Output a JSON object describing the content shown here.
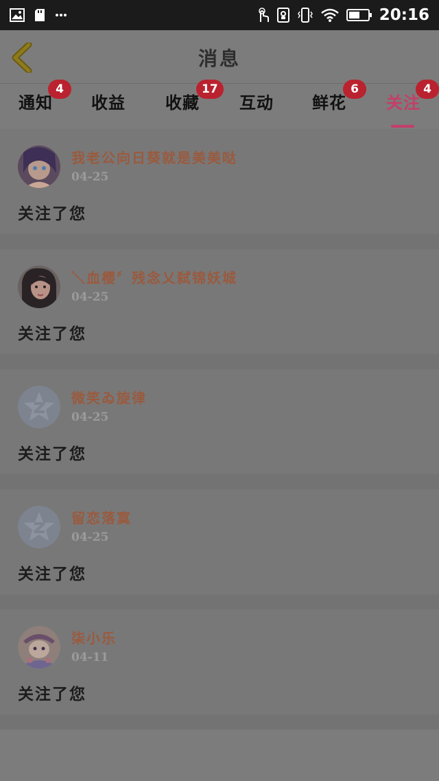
{
  "status_bar": {
    "time": "20:16",
    "left_icons": [
      "image-icon",
      "sd-card-icon",
      "more-icon"
    ],
    "right_icons": [
      "touch-icon",
      "portrait-lock-icon",
      "vibrate-icon",
      "wifi-icon",
      "battery-icon"
    ]
  },
  "header": {
    "title": "消息",
    "back_icon": "chevron-left-icon"
  },
  "tabs": [
    {
      "label": "通知",
      "badge": "4",
      "active": false
    },
    {
      "label": "收益",
      "badge": "",
      "active": false
    },
    {
      "label": "收藏",
      "badge": "17",
      "active": false
    },
    {
      "label": "互动",
      "badge": "",
      "active": false
    },
    {
      "label": "鲜花",
      "badge": "6",
      "active": false
    },
    {
      "label": "关注",
      "badge": "4",
      "active": true
    }
  ],
  "messages": [
    {
      "username": "我老公向日葵就是美美哒",
      "date": "04-25",
      "action": "关注了您",
      "avatar": "anime-avatar"
    },
    {
      "username": "＼血樱〞残念乂弑锦妖城",
      "date": "04-25",
      "action": "关注了您",
      "avatar": "photo-avatar"
    },
    {
      "username": "微笑ゐ旋律",
      "date": "04-25",
      "action": "关注了您",
      "avatar": "default-avatar"
    },
    {
      "username": "留恋落寞",
      "date": "04-25",
      "action": "关注了您",
      "avatar": "default-avatar"
    },
    {
      "username": "柒小乐",
      "date": "04-11",
      "action": "关注了您",
      "avatar": "anime-avatar"
    }
  ],
  "colors": {
    "accent": "#c43e69",
    "badge": "#b9222e",
    "username": "#9a5a3e",
    "overlay_bg": "#7c7c7c"
  }
}
